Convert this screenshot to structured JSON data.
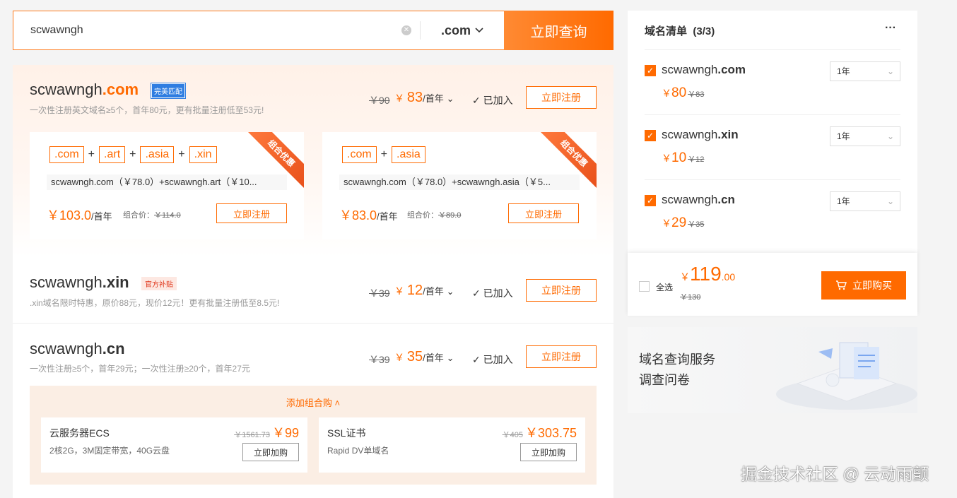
{
  "search": {
    "value": "scwawngh",
    "suffix": ".com",
    "button": "立即查询"
  },
  "results": [
    {
      "prefix": "scwawngh",
      "suffix": ".com",
      "badge": "完美匹配",
      "desc": "一次性注册英文域名≥5个，首年80元，更有批量注册低至53元!",
      "old": "￥90",
      "price_symbol": "￥",
      "price": "83",
      "unit": "/首年",
      "added": "已加入",
      "register": "立即注册"
    },
    {
      "prefix": "scwawngh",
      "suffix": ".xin",
      "badge": "官方补贴",
      "desc": ".xin域名限时特惠，原价88元，现价12元！更有批量注册低至8.5元!",
      "old": "￥39",
      "price_symbol": "￥",
      "price": "12",
      "unit": "/首年",
      "added": "已加入",
      "register": "立即注册"
    },
    {
      "prefix": "scwawngh",
      "suffix": ".cn",
      "desc": "一次性注册≥5个，首年29元；一次性注册≥20个，首年27元",
      "old": "￥39",
      "price_symbol": "￥",
      "price": "35",
      "unit": "/首年",
      "added": "已加入",
      "register": "立即注册"
    }
  ],
  "combos": [
    {
      "chips": [
        ".com",
        ".art",
        ".asia",
        ".xin"
      ],
      "desc": "scwawngh.com（￥78.0）+scwawngh.art（￥10...",
      "price": "￥103.0",
      "unit": "/首年",
      "old_label": "组合价：",
      "old": "￥114.0",
      "button": "立即注册",
      "ribbon": "组合优惠"
    },
    {
      "chips": [
        ".com",
        ".asia"
      ],
      "desc": "scwawngh.com（￥78.0）+scwawngh.asia（￥5...",
      "price": "￥83.0",
      "unit": "/首年",
      "old_label": "组合价：",
      "old": "￥89.0",
      "button": "立即注册",
      "ribbon": "组合优惠"
    }
  ],
  "addon": {
    "title": "添加组合购",
    "items": [
      {
        "name": "云服务器ECS",
        "spec": "2核2G，3M固定带宽，40G云盘",
        "old": "￥1561.73",
        "price": "￥99",
        "button": "立即加购"
      },
      {
        "name": "SSL证书",
        "spec": "Rapid DV单域名",
        "old": "￥405",
        "price": "￥303.75",
        "button": "立即加购"
      }
    ]
  },
  "cart": {
    "title": "域名清单",
    "count": "(3/3)",
    "more": "···",
    "items": [
      {
        "prefix": "scwawngh",
        "suffix": ".com",
        "price_symbol": "￥",
        "price": "80",
        "old": "￥83",
        "term": "1年"
      },
      {
        "prefix": "scwawngh",
        "suffix": ".xin",
        "price_symbol": "￥",
        "price": "10",
        "old": "￥12",
        "term": "1年"
      },
      {
        "prefix": "scwawngh",
        "suffix": ".cn",
        "price_symbol": "￥",
        "price": "29",
        "old": "￥35",
        "term": "1年"
      }
    ],
    "select_all": "全选",
    "total_symbol": "￥",
    "total_int": "119",
    "total_dec": ".00",
    "total_old": "￥130",
    "buy": "立即购买"
  },
  "survey": {
    "line1": "域名查询服务",
    "line2": "调查问卷"
  },
  "watermark": "掘金技术社区 @ 云动雨颤",
  "colors": {
    "accent": "#ff6a00",
    "badge_blue": "#2f7de1"
  }
}
